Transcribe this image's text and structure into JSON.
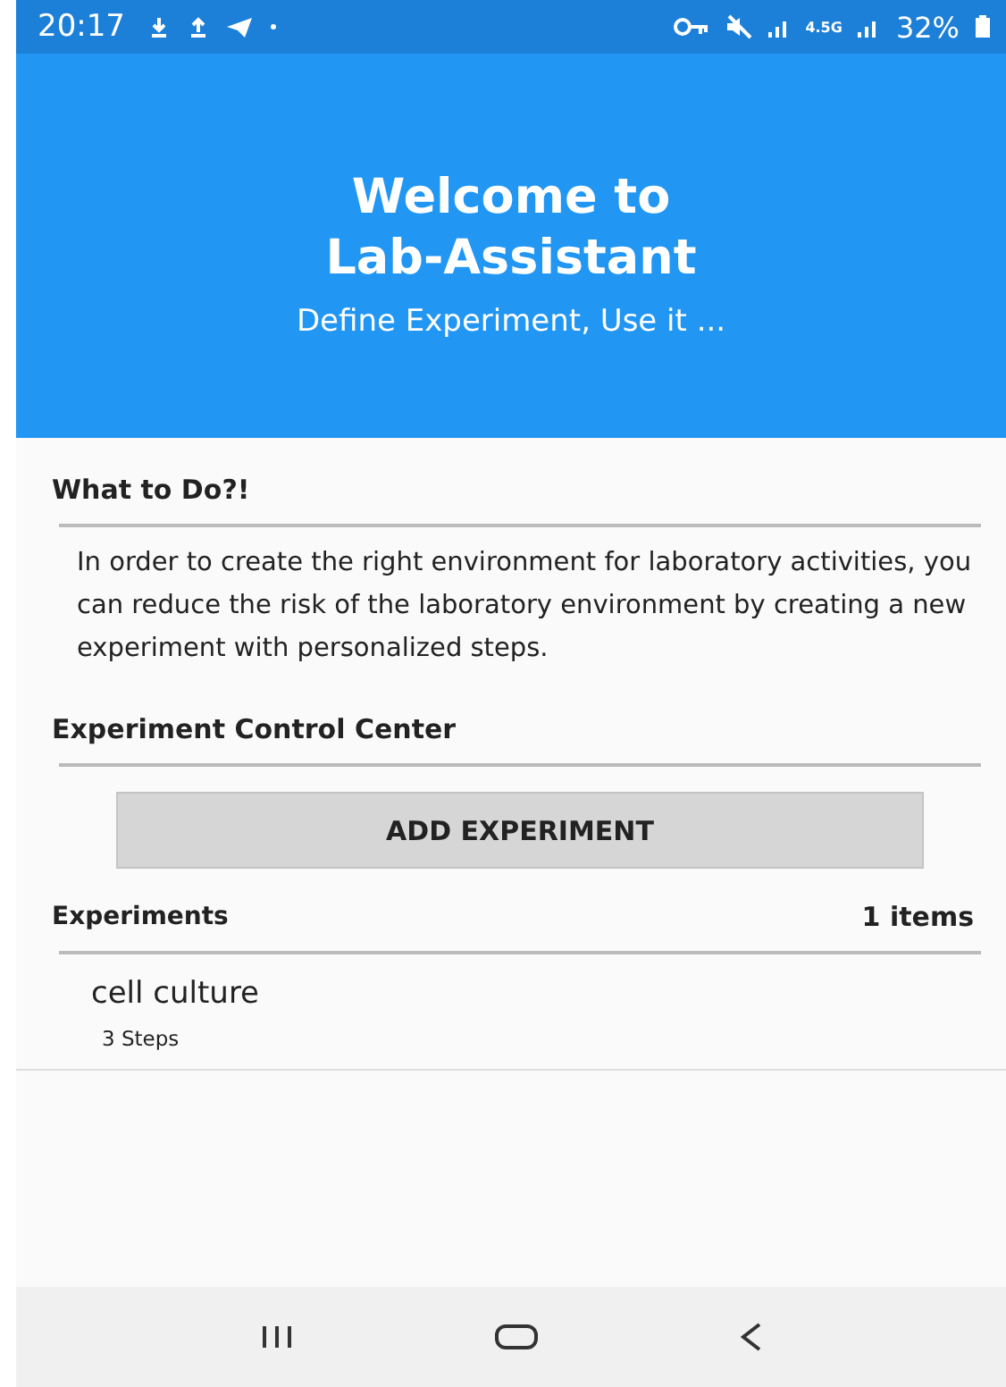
{
  "status_bar": {
    "time": "20:17",
    "network_type": "4.5G",
    "battery": "32%"
  },
  "header": {
    "title_lines": [
      "Welcome to",
      "Lab-Assistant"
    ],
    "subtitle": "Define Experiment, Use it ..."
  },
  "intro": {
    "heading": "What to Do?!",
    "text": "In order to create the right environment for laboratory activities, you can reduce the risk of the laboratory environment by creating a new experiment with personalized steps."
  },
  "control_center": {
    "heading": "Experiment Control Center",
    "button": "ADD EXPERIMENT"
  },
  "experiments": {
    "heading": "Experiments",
    "count": "1 items",
    "items": [
      {
        "name": "cell culture",
        "steps": "3 Steps"
      }
    ]
  }
}
